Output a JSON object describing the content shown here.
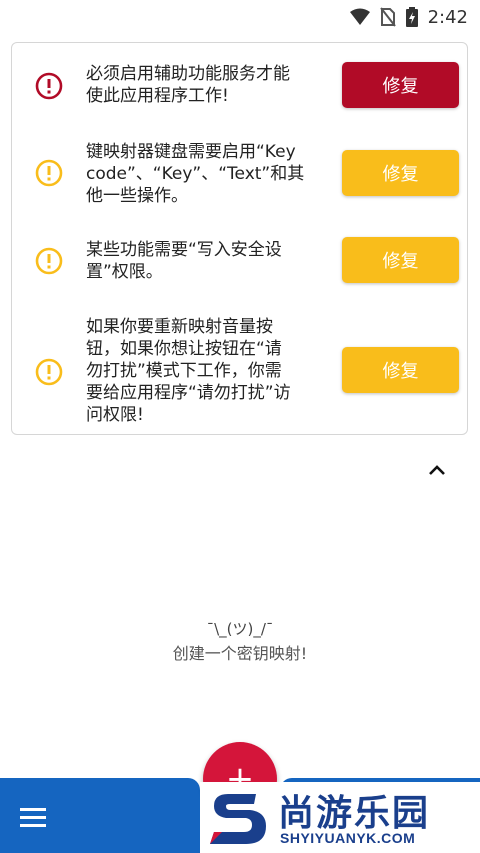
{
  "status_bar": {
    "time": "2:42",
    "icons": [
      "wifi-icon",
      "no-sim-icon",
      "battery-icon"
    ]
  },
  "issues": [
    {
      "severity": "error",
      "icon": "error-circle-icon",
      "message": "必须启用辅助功能服务才能\n使此应用程序工作!",
      "button_label": "修复",
      "color": "#b10b27"
    },
    {
      "severity": "warning",
      "icon": "warning-circle-icon",
      "message": "键映射器键盘需要启用“Key\ncode”、“Key”、“Text”和其\n他一些操作。",
      "button_label": "修复",
      "color": "#f9bd1b"
    },
    {
      "severity": "warning",
      "icon": "warning-circle-icon",
      "message": "某些功能需要“写入安全设\n置”权限。",
      "button_label": "修复",
      "color": "#f9bd1b"
    },
    {
      "severity": "warning",
      "icon": "warning-circle-icon",
      "message": "如果你要重新映射音量按\n钮，如果你想让按钮在“请\n勿打扰”模式下工作，你需\n要给应用程序“请勿打扰”访\n问权限!",
      "button_label": "修复",
      "color": "#f9bd1b"
    }
  ],
  "collapse_icon": "chevron-up-icon",
  "empty_state": {
    "face": "¯\\_(ツ)_/¯",
    "message": "创建一个密钥映射!"
  },
  "bottom_bar": {
    "menu_icon": "menu-icon",
    "fab_icon": "plus-icon",
    "fab_label": "+",
    "color": "#1565c0",
    "fab_color": "#d4153a"
  },
  "watermark": {
    "title": "尚游乐园",
    "subtitle": "SHYIYUANYK.COM"
  }
}
